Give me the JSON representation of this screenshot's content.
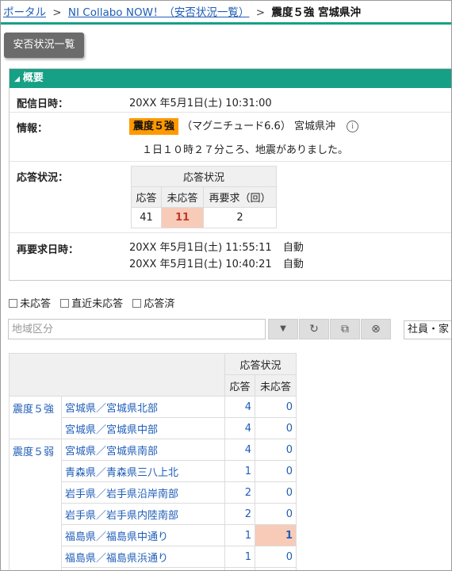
{
  "breadcrumb": {
    "portal": "ポータル",
    "sep1": ">",
    "list": "NI Collabo NOW！（安否状況一覧）",
    "sep2": ">",
    "current": "震度５強 宮城県沖"
  },
  "page_button": "安否状況一覧",
  "overview": {
    "title": "概要",
    "delivery_label": "配信日時：",
    "delivery_value": "20XX 年5月1日(土) 10:31:00",
    "info_label": "情報：",
    "info_badge": "震度５強",
    "info_magnitude": "（マグニチュード6.6）",
    "info_area": "宮城県沖",
    "info_icon": "info-icon",
    "info_message": "１日１０時２７分ころ、地震がありました。",
    "response_label": "応答状況：",
    "response_table": {
      "title": "応答状況",
      "headers": [
        "応答",
        "未応答",
        "再要求（回）"
      ],
      "values": [
        "41",
        "11",
        "2"
      ]
    },
    "rerequest_label": "再要求日時：",
    "rerequests": [
      {
        "datetime": "20XX 年5月1日(土) 11:55:11",
        "mode": "自動"
      },
      {
        "datetime": "20XX 年5月1日(土) 10:40:21",
        "mode": "自動"
      }
    ]
  },
  "filters": {
    "unanswered": "未応答",
    "recent_unanswered": "直近未応答",
    "answered": "応答済"
  },
  "search": {
    "placeholder": "地域区分",
    "dropdown_icon": "chevron-down-icon",
    "reset_icon": "reset-icon",
    "copy_icon": "copy-icon",
    "clear_icon": "clear-icon",
    "type_value": "社員・家"
  },
  "grid": {
    "group_header": "応答状況",
    "headers": [
      "応答",
      "未応答"
    ],
    "rows": [
      {
        "level": "震度５強",
        "area": "宮城県／宮城県北部",
        "answered": "4",
        "unanswered": "0"
      },
      {
        "level": "",
        "area": "宮城県／宮城県中部",
        "answered": "4",
        "unanswered": "0"
      },
      {
        "level": "震度５弱",
        "area": "宮城県／宮城県南部",
        "answered": "4",
        "unanswered": "0"
      },
      {
        "level": "",
        "area": "青森県／青森県三八上北",
        "answered": "1",
        "unanswered": "0"
      },
      {
        "level": "",
        "area": "岩手県／岩手県沿岸南部",
        "answered": "2",
        "unanswered": "0"
      },
      {
        "level": "",
        "area": "岩手県／岩手県内陸南部",
        "answered": "2",
        "unanswered": "0"
      },
      {
        "level": "",
        "area": "福島県／福島県中通り",
        "answered": "1",
        "unanswered": "1"
      },
      {
        "level": "",
        "area": "福島県／福島県浜通り",
        "answered": "1",
        "unanswered": "0"
      }
    ]
  },
  "colors": {
    "accent": "#16a085",
    "badge": "#ff9900",
    "highlight": "#f8cbb8",
    "link": "#1e5db8"
  }
}
